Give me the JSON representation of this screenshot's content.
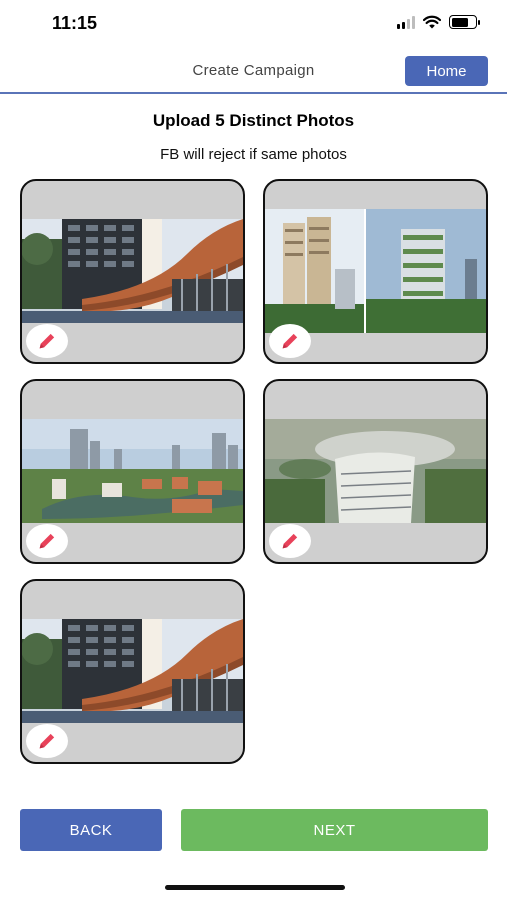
{
  "status_bar": {
    "time": "11:15"
  },
  "header": {
    "title": "Create Campaign",
    "home_label": "Home"
  },
  "upload": {
    "heading": "Upload 5 Distinct Photos",
    "subtext": "FB will reject if same photos"
  },
  "photos": [
    {
      "scene": "condo-tower-copper-canopy"
    },
    {
      "scene": "two-residential-towers-split"
    },
    {
      "scene": "aerial-city-river"
    },
    {
      "scene": "aerial-curved-tower-greenery"
    },
    {
      "scene": "condo-tower-copper-canopy"
    }
  ],
  "icons": {
    "edit": "pencil-icon"
  },
  "colors": {
    "primary": "#4a67b6",
    "success": "#6cba5f",
    "edit_icon": "#e8425a",
    "card_bg": "#cfcfcf"
  },
  "footer": {
    "back_label": "BACK",
    "next_label": "NEXT"
  }
}
